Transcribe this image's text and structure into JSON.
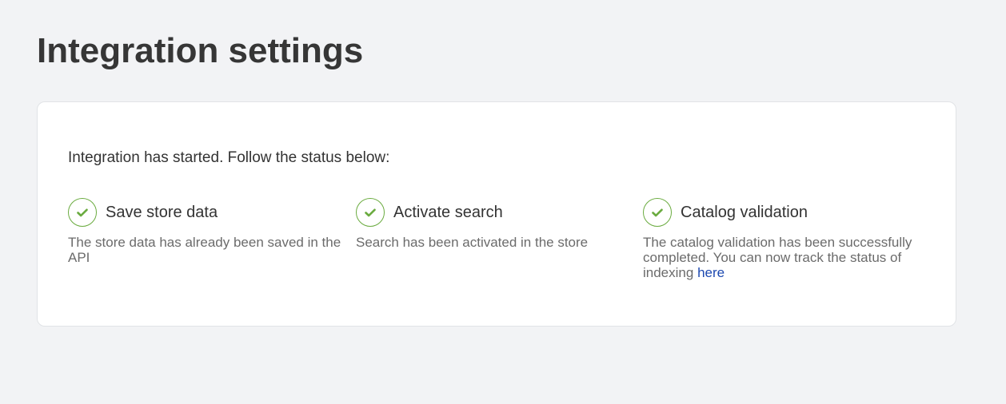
{
  "page": {
    "title": "Integration settings"
  },
  "status_card": {
    "intro": "Integration has started. Follow the status below:",
    "steps": [
      {
        "title": "Save store data",
        "description": "The store data has already been saved in the API",
        "state_icon": "check-icon"
      },
      {
        "title": "Activate search",
        "description": "Search has been activated in the store",
        "state_icon": "check-icon"
      },
      {
        "title": "Catalog validation",
        "description": "The catalog validation has been successfully completed. You can now track the status of indexing",
        "link_text": "here",
        "state_icon": "check-icon"
      }
    ]
  },
  "colors": {
    "background": "#f2f3f5",
    "card": "#ffffff",
    "success": "#6aab3f",
    "link": "#1d49b0"
  }
}
